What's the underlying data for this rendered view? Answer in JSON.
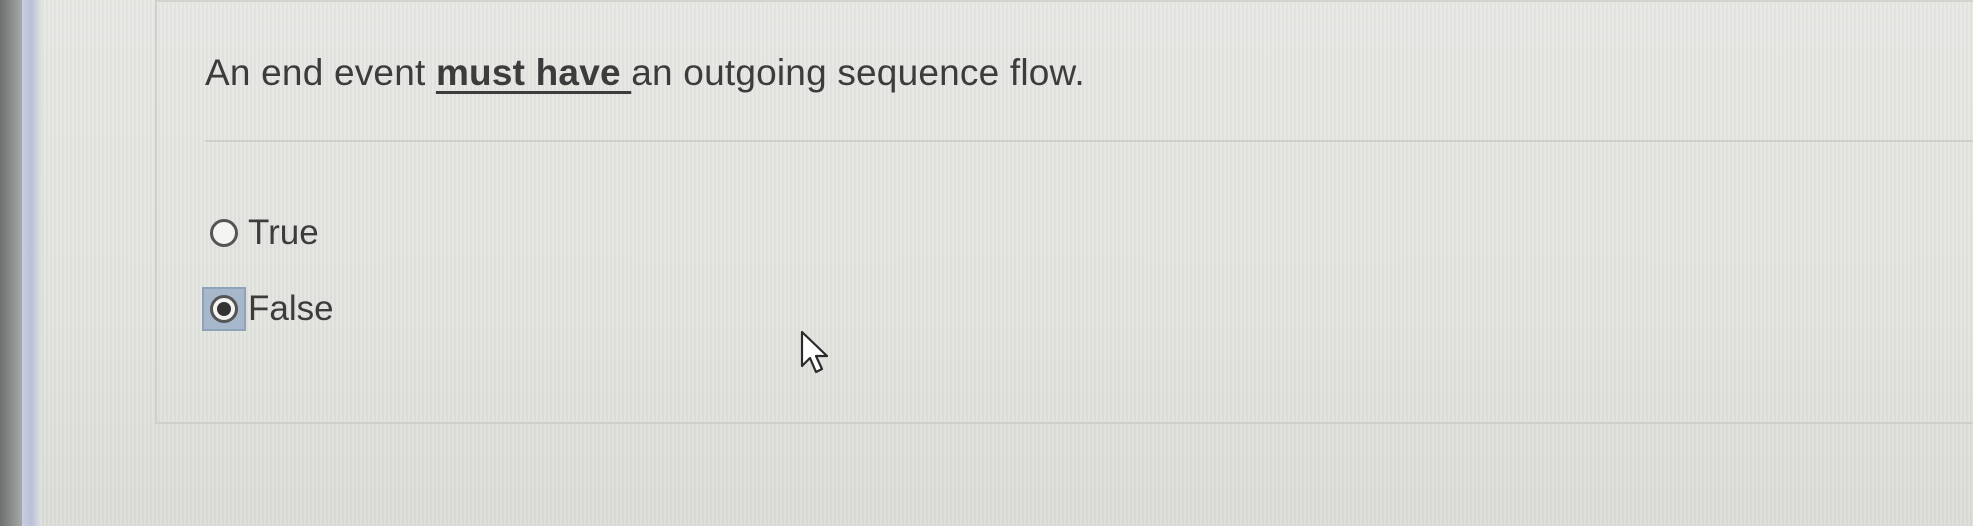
{
  "question": {
    "text_before": "An end event ",
    "emphasis": "must have ",
    "text_after": "an outgoing sequence flow."
  },
  "options": [
    {
      "label": "True",
      "selected": false
    },
    {
      "label": "False",
      "selected": true
    }
  ],
  "colors": {
    "background": "#e6e7e3",
    "text": "#3c3c3c",
    "focus_highlight": "#a7b8cc"
  }
}
